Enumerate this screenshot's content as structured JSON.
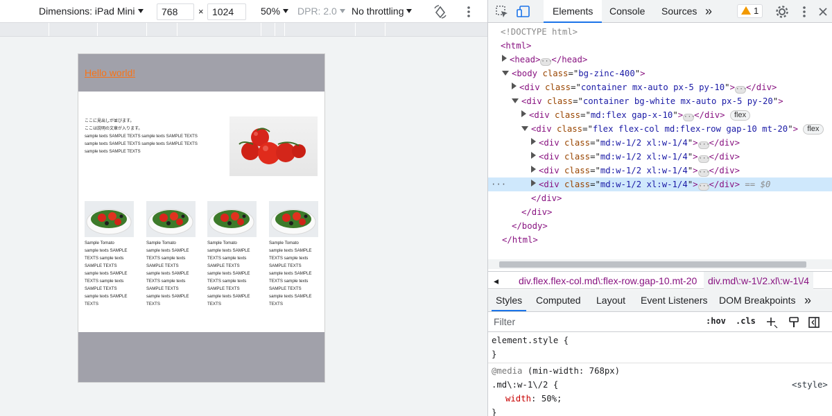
{
  "device_toolbar": {
    "dimensions_label": "Dimensions: iPad Mini",
    "width": "768",
    "times": "×",
    "height": "1024",
    "zoom": "50%",
    "dpr": "DPR: 2.0",
    "throttling": "No throttling"
  },
  "page": {
    "header_link": "Hello world!",
    "intro_lines": [
      "ここに見出しが並びます。",
      "ここは説明の文章が入ります。",
      "sample texts SAMPLE TEXTS sample texts SAMPLE TEXTS",
      "sample texts SAMPLE TEXTS sample texts SAMPLE TEXTS",
      "sample texts SAMPLE TEXTS"
    ],
    "card_lines": [
      "Sample Tomato",
      "sample texts SAMPLE",
      "TEXTS sample texts",
      "SAMPLE TEXTS",
      "sample texts SAMPLE",
      "TEXTS sample texts",
      "SAMPLE TEXTS",
      "sample texts SAMPLE",
      "TEXTS"
    ]
  },
  "devtools": {
    "tabs": [
      "Elements",
      "Console",
      "Sources"
    ],
    "more_tabs": "»",
    "warnings": "1",
    "dom": {
      "doctype": "<!DOCTYPE html>",
      "html_open": "<html>",
      "head_open": "<head>",
      "head_close": "</head>",
      "body_open": "<body",
      "body_class": "bg-zinc-400",
      "div_open": "<div",
      "div_close": "</div>",
      "body_close": "</body>",
      "html_close": "</html>",
      "class_attr": "class",
      "container1_class": "container mx-auto px-5 py-10",
      "container2_class": "container bg-white mx-auto px-5 py-20",
      "mdflex_class": "md:flex gap-x-10",
      "flexcol_class": "flex flex-col md:flex-row gap-10 mt-20",
      "col_class": "md:w-1/2 xl:w-1/4",
      "flex_badge": "flex",
      "selected_suffix": "== $0"
    },
    "breadcrumbs": [
      "div.flex.flex-col.md\\:flex-row.gap-10.mt-20",
      "div.md\\:w-1\\/2.xl\\:w-1\\/4"
    ],
    "subtabs": [
      "Styles",
      "Computed",
      "Layout",
      "Event Listeners",
      "DOM Breakpoints"
    ],
    "filter_placeholder": "Filter",
    "hov": ":hov",
    "cls": ".cls",
    "styles": {
      "element_style": "element.style {",
      "close": "}",
      "media": "@media",
      "media_query": "(min-width: 768px)",
      "selector": ".md\\:w-1\\/2 {",
      "source": "<style>",
      "prop": "width",
      "value": "50%;"
    }
  },
  "colors": {
    "accent": "#1a73e8",
    "header_gray": "#a1a1aa",
    "link_orange": "#f97316",
    "selected_row": "#cfe8fc"
  }
}
